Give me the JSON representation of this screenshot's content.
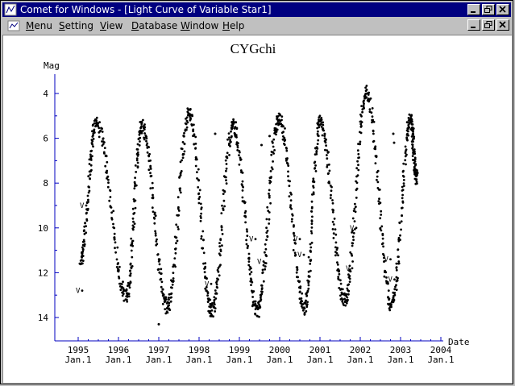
{
  "window": {
    "title": "Comet for Windows - [Light Curve of Variable Star1]"
  },
  "menu": {
    "items": [
      {
        "key": "M",
        "rest": "enu"
      },
      {
        "key": "S",
        "rest": "etting"
      },
      {
        "key": "V",
        "rest": "iew"
      },
      {
        "key": "D",
        "rest": "atabase"
      },
      {
        "key": "W",
        "rest": "indow"
      },
      {
        "key": "H",
        "rest": "elp"
      }
    ]
  },
  "colors": {
    "titlebar": "#000080",
    "axis": "#0000c0",
    "point": "#000000"
  },
  "chart_data": {
    "type": "scatter",
    "title": "CYGchi",
    "ylabel": "Mag",
    "xlabel": "Date",
    "y_inverted": true,
    "ylim": [
      15,
      3
    ],
    "xlim": [
      1994.6,
      2004.0
    ],
    "y_ticks": [
      4,
      6,
      8,
      10,
      12,
      14
    ],
    "x_ticks": [
      {
        "year": "1995",
        "sub": "Jan.1"
      },
      {
        "year": "1996",
        "sub": "Jan.1"
      },
      {
        "year": "1997",
        "sub": "Jan.1"
      },
      {
        "year": "1998",
        "sub": "Jan.1"
      },
      {
        "year": "1999",
        "sub": "Jan.1"
      },
      {
        "year": "2000",
        "sub": "Jan.1"
      },
      {
        "year": "2001",
        "sub": "Jan.1"
      },
      {
        "year": "2002",
        "sub": "Jan.1"
      },
      {
        "year": "2003",
        "sub": "Jan.1"
      },
      {
        "year": "2004",
        "sub": "Jan.1"
      }
    ],
    "cycle_extrema": [
      [
        1995.05,
        11.5
      ],
      [
        1995.45,
        5.3
      ],
      [
        1996.2,
        13.1
      ],
      [
        1996.58,
        5.4
      ],
      [
        1997.22,
        13.6
      ],
      [
        1997.75,
        4.9
      ],
      [
        1998.32,
        13.7
      ],
      [
        1998.85,
        5.4
      ],
      [
        1999.45,
        13.7
      ],
      [
        1999.98,
        5.1
      ],
      [
        2000.62,
        13.6
      ],
      [
        2001.0,
        5.3
      ],
      [
        2001.62,
        13.2
      ],
      [
        2002.15,
        3.9
      ],
      [
        2002.78,
        13.4
      ],
      [
        2003.25,
        5.2
      ],
      [
        2003.4,
        7.8
      ]
    ],
    "sample_points": [
      {
        "x": 1995.0,
        "y": 12.8,
        "v": true
      },
      {
        "x": 1995.1,
        "y": 9.0,
        "v": true
      },
      {
        "x": 1997.15,
        "y": 13.2,
        "v": true
      },
      {
        "x": 1997.0,
        "y": 14.3,
        "v": false
      },
      {
        "x": 1998.2,
        "y": 12.5,
        "v": true
      },
      {
        "x": 1998.4,
        "y": 5.8,
        "v": false
      },
      {
        "x": 1999.3,
        "y": 10.5,
        "v": true
      },
      {
        "x": 1999.5,
        "y": 11.5,
        "v": true
      },
      {
        "x": 1999.55,
        "y": 6.3,
        "v": false
      },
      {
        "x": 1999.75,
        "y": 5.9,
        "v": false
      },
      {
        "x": 2000.4,
        "y": 10.5,
        "v": true
      },
      {
        "x": 2000.5,
        "y": 11.2,
        "v": true
      },
      {
        "x": 2001.7,
        "y": 11.8,
        "v": true
      },
      {
        "x": 2001.8,
        "y": 10.0,
        "v": true
      },
      {
        "x": 2002.65,
        "y": 11.4,
        "v": true
      },
      {
        "x": 2002.75,
        "y": 12.3,
        "v": true
      },
      {
        "x": 2002.82,
        "y": 5.8,
        "v": false
      },
      {
        "x": 2002.84,
        "y": 6.2,
        "v": false
      }
    ]
  }
}
